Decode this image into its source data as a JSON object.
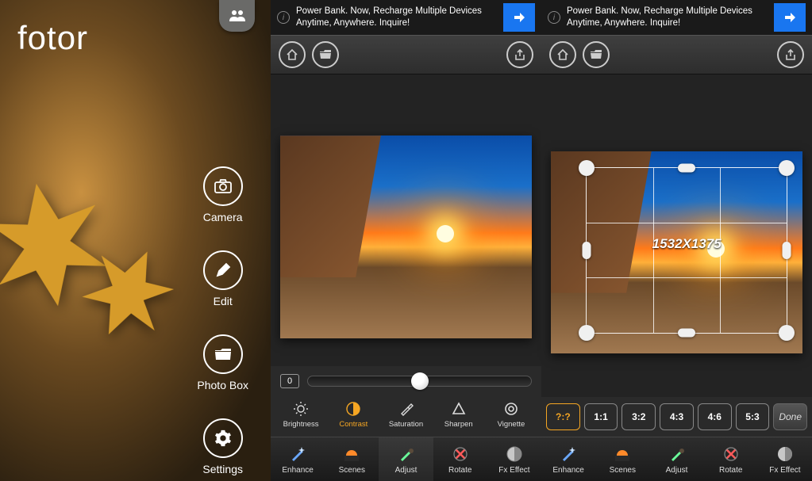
{
  "brand": "fotor",
  "home_menu": {
    "camera": "Camera",
    "edit": "Edit",
    "photobox": "Photo Box",
    "settings": "Settings"
  },
  "ad": {
    "text": "Power Bank. Now, Recharge Multiple Devices Anytime, Anywhere. Inquire!"
  },
  "adjust": {
    "slider_value": "0",
    "tabs": {
      "brightness": "Brightness",
      "contrast": "Contrast",
      "saturation": "Saturation",
      "sharpen": "Sharpen",
      "vignette": "Vignette"
    },
    "active": "Contrast"
  },
  "crop": {
    "dimensions": "1532X1375",
    "ratios": [
      "?:?",
      "1:1",
      "3:2",
      "4:3",
      "4:6",
      "5:3"
    ],
    "active_ratio": "?:?",
    "done": "Done"
  },
  "main_tabs": {
    "enhance": "Enhance",
    "scenes": "Scenes",
    "adjust": "Adjust",
    "rotate": "Rotate",
    "fx": "Fx Effect"
  }
}
